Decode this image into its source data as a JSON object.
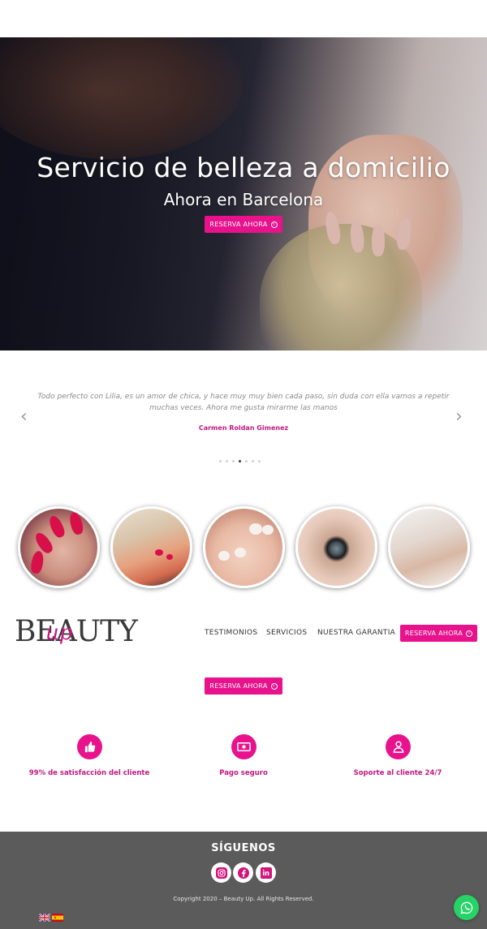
{
  "hero": {
    "title": "Servicio de belleza a domicilio",
    "subtitle": "Ahora en Barcelona",
    "cta_label": "RESERVA AHORA"
  },
  "testimonial": {
    "quote": "Todo perfecto con Lilia, es un amor de chica, y hace muy muy bien cada paso, sin duda con ella vamos a repetir muchas veces. Ahora me gusta mirarme las manos",
    "author": "Carmen Roldan Gimenez",
    "prev_icon": "chevron-left-icon",
    "next_icon": "chevron-right-icon",
    "slide_count": 7,
    "active_slide": 4
  },
  "services": [
    {
      "name": "manicure-red-nails"
    },
    {
      "name": "pedicure-red-toes"
    },
    {
      "name": "french-pedicure"
    },
    {
      "name": "eyelash-extension"
    },
    {
      "name": "leg-waxing"
    }
  ],
  "nav": {
    "logo_main": "BEAUTY",
    "logo_accent": "up",
    "links": [
      "TESTIMONIOS",
      "SERVICIOS",
      "NUESTRA GARANTIA"
    ],
    "cta_label": "RESERVA AHORA"
  },
  "mid_cta_label": "RESERVA AHORA",
  "features": [
    {
      "icon": "thumbs-up-icon",
      "label": "99% de satisfacción del cliente"
    },
    {
      "icon": "money-bill-icon",
      "label": "Pago seguro"
    },
    {
      "icon": "user-icon",
      "label": "Soporte al cliente 24/7"
    }
  ],
  "footer": {
    "follow_title": "SÍGUENOS",
    "social": [
      "instagram-icon",
      "facebook-icon",
      "linkedin-icon"
    ],
    "copyright": "Copyright 2020 – Beauty Up. All Rights Reserved.",
    "languages": [
      "english-flag-icon",
      "spanish-flag-icon"
    ]
  },
  "colors": {
    "accent": "#e8128c",
    "accent_text": "#c2187f",
    "footer_bg": "#5b5b5b",
    "whatsapp": "#25d366"
  }
}
